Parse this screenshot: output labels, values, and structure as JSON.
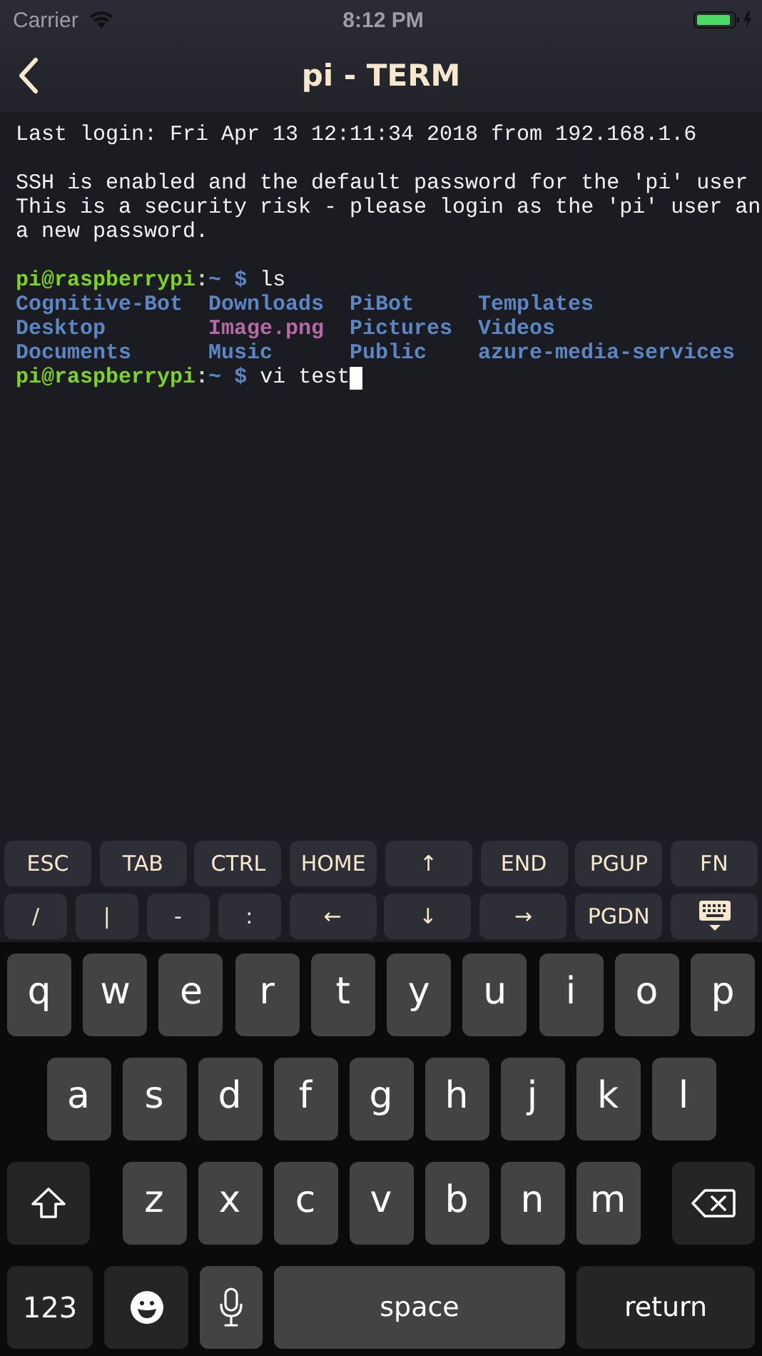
{
  "status_bar": {
    "carrier": "Carrier",
    "time": "8:12 PM"
  },
  "nav": {
    "title": "pi - TERM"
  },
  "terminal": {
    "lines": [
      {
        "kind": "output",
        "text": "Last login: Fri Apr 13 12:11:34 2018 from 192.168.1.6"
      },
      {
        "kind": "blank"
      },
      {
        "kind": "output",
        "text": "SSH is enabled and the default password for the 'pi' user"
      },
      {
        "kind": "output",
        "text": "This is a security risk - please login as the 'pi' user an"
      },
      {
        "kind": "output",
        "text": "a new password."
      },
      {
        "kind": "blank"
      },
      {
        "kind": "prompt",
        "user": "pi@raspberrypi",
        "separator": ":",
        "path": "~",
        "symbol": "$",
        "command": "ls",
        "cursor": false
      },
      {
        "kind": "listing",
        "entries": [
          {
            "name": "Cognitive-Bot",
            "kind": "dir"
          },
          {
            "name": "Downloads",
            "kind": "dir"
          },
          {
            "name": "PiBot",
            "kind": "dir"
          },
          {
            "name": "Templates",
            "kind": "dir"
          }
        ]
      },
      {
        "kind": "listing",
        "entries": [
          {
            "name": "Desktop",
            "kind": "dir"
          },
          {
            "name": "Image.png",
            "kind": "image"
          },
          {
            "name": "Pictures",
            "kind": "dir"
          },
          {
            "name": "Videos",
            "kind": "dir"
          }
        ]
      },
      {
        "kind": "listing",
        "entries": [
          {
            "name": "Documents",
            "kind": "dir"
          },
          {
            "name": "Music",
            "kind": "dir"
          },
          {
            "name": "Public",
            "kind": "dir"
          },
          {
            "name": "azure-media-services",
            "kind": "dir"
          }
        ]
      },
      {
        "kind": "prompt",
        "user": "pi@raspberrypi",
        "separator": ":",
        "path": "~",
        "symbol": "$",
        "command": "vi test",
        "cursor": true
      }
    ]
  },
  "accessory_keys": [
    [
      {
        "kind": "text",
        "label": "ESC",
        "narrow": false
      },
      {
        "kind": "text",
        "label": "TAB",
        "narrow": false
      },
      {
        "kind": "text",
        "label": "CTRL",
        "narrow": false
      },
      {
        "kind": "text",
        "label": "HOME",
        "narrow": false
      },
      {
        "kind": "text",
        "label": "↑",
        "narrow": false
      },
      {
        "kind": "text",
        "label": "END",
        "narrow": false
      },
      {
        "kind": "text",
        "label": "PGUP",
        "narrow": false
      },
      {
        "kind": "text",
        "label": "FN",
        "narrow": false
      }
    ],
    [
      {
        "kind": "text",
        "label": "/",
        "narrow": true
      },
      {
        "kind": "text",
        "label": "|",
        "narrow": true
      },
      {
        "kind": "text",
        "label": "-",
        "narrow": true
      },
      {
        "kind": "text",
        "label": ":",
        "narrow": true
      },
      {
        "kind": "text",
        "label": "←",
        "narrow": false
      },
      {
        "kind": "text",
        "label": "↓",
        "narrow": false
      },
      {
        "kind": "text",
        "label": "→",
        "narrow": false
      },
      {
        "kind": "text",
        "label": "PGDN",
        "narrow": false
      },
      {
        "kind": "hide-keyboard",
        "narrow": false
      }
    ]
  ],
  "keyboard": [
    [
      {
        "kind": "letter",
        "label": "q"
      },
      {
        "kind": "letter",
        "label": "w"
      },
      {
        "kind": "letter",
        "label": "e"
      },
      {
        "kind": "letter",
        "label": "r"
      },
      {
        "kind": "letter",
        "label": "t"
      },
      {
        "kind": "letter",
        "label": "y"
      },
      {
        "kind": "letter",
        "label": "u"
      },
      {
        "kind": "letter",
        "label": "i"
      },
      {
        "kind": "letter",
        "label": "o"
      },
      {
        "kind": "letter",
        "label": "p"
      }
    ],
    [
      {
        "kind": "letter",
        "label": "a"
      },
      {
        "kind": "letter",
        "label": "s"
      },
      {
        "kind": "letter",
        "label": "d"
      },
      {
        "kind": "letter",
        "label": "f"
      },
      {
        "kind": "letter",
        "label": "g"
      },
      {
        "kind": "letter",
        "label": "h"
      },
      {
        "kind": "letter",
        "label": "j"
      },
      {
        "kind": "letter",
        "label": "k"
      },
      {
        "kind": "letter",
        "label": "l"
      }
    ],
    [
      {
        "kind": "shift"
      },
      {
        "kind": "letter",
        "label": "z"
      },
      {
        "kind": "letter",
        "label": "x"
      },
      {
        "kind": "letter",
        "label": "c"
      },
      {
        "kind": "letter",
        "label": "v"
      },
      {
        "kind": "letter",
        "label": "b"
      },
      {
        "kind": "letter",
        "label": "n"
      },
      {
        "kind": "letter",
        "label": "m"
      },
      {
        "kind": "backspace"
      }
    ],
    [
      {
        "kind": "mode",
        "label": "123"
      },
      {
        "kind": "emoji"
      },
      {
        "kind": "mic"
      },
      {
        "kind": "space",
        "label": "space"
      },
      {
        "kind": "return",
        "label": "return"
      }
    ]
  ]
}
